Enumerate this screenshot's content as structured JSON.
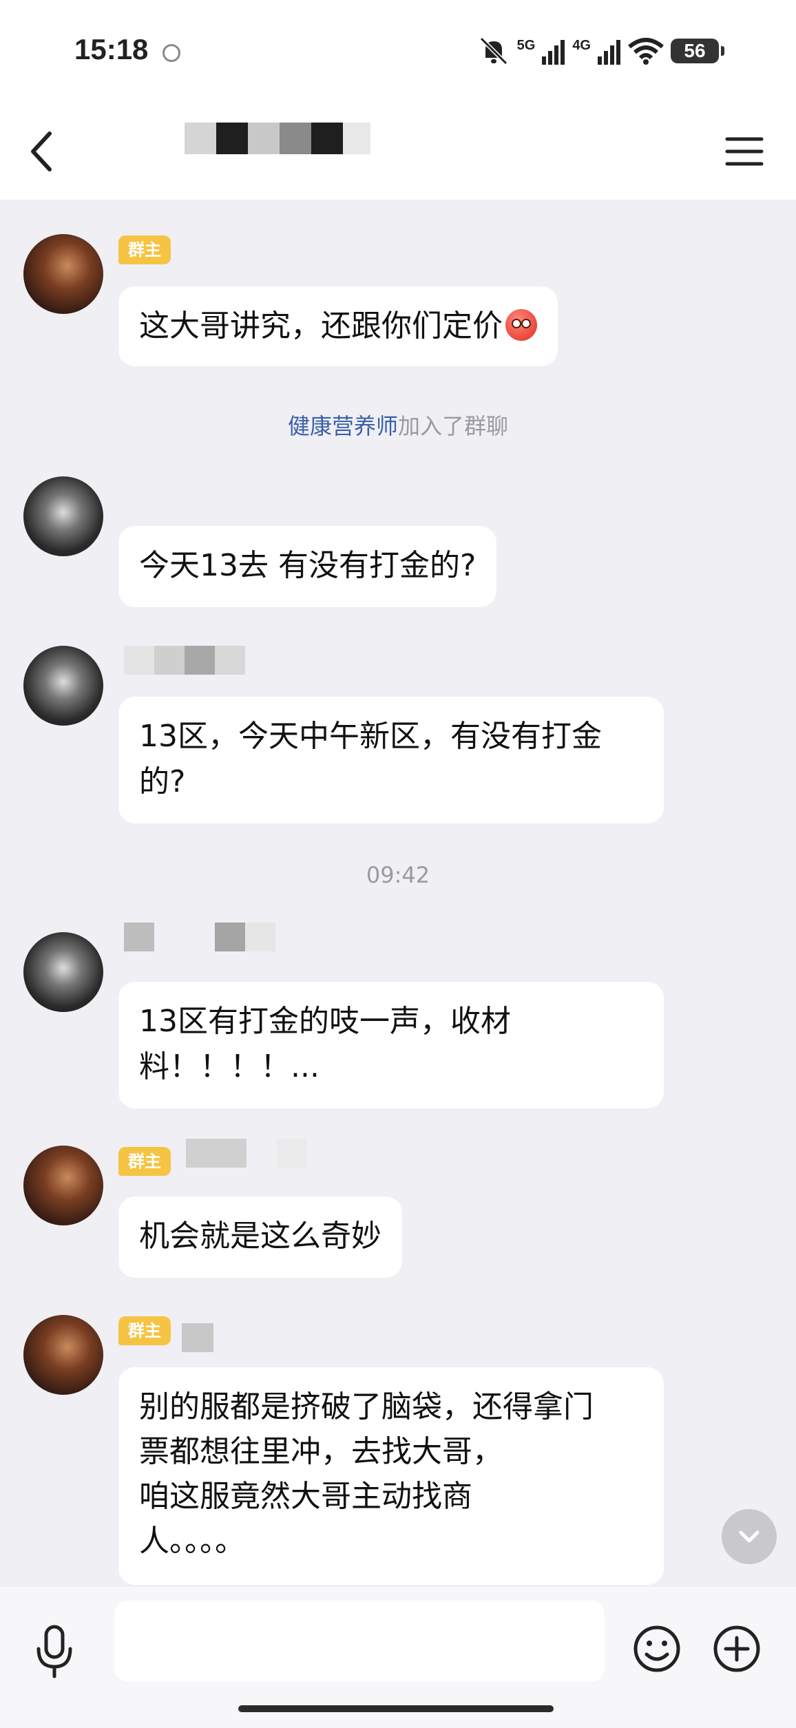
{
  "status_bar": {
    "time": "15:18",
    "network_5g": "5G",
    "network_4g": "4G",
    "battery": "56"
  },
  "nav": {
    "back_icon": "chevron-left-icon",
    "menu_icon": "hamburger-menu-icon"
  },
  "messages": [
    {
      "sender_role": "owner",
      "badge": "群主",
      "text": "这大哥讲究，还跟你们定价",
      "emoji": "flushed-face-emoji"
    },
    {
      "sender_role": "member",
      "text": "今天13去 有没有打金的?"
    },
    {
      "sender_role": "member",
      "line1": "13区，今天中午新区，有没有打金",
      "line2": "的?"
    },
    {
      "sender_role": "member",
      "line1": "13区有打金的吱一声，收材",
      "line2": "料！！！！..."
    },
    {
      "sender_role": "owner",
      "badge": "群主",
      "text": "机会就是这么奇妙"
    },
    {
      "sender_role": "owner",
      "badge": "群主",
      "line1": "别的服都是挤破了脑袋，还得拿门",
      "line2": "票都想往里冲，去找大哥，",
      "line3": "咱这服竟然大哥主动找商",
      "line4": "人。。。。"
    }
  ],
  "system_message": {
    "name": "健康营养师",
    "action": "加入了群聊"
  },
  "time_separator": "09:42",
  "input_bar": {
    "placeholder": "",
    "mic_icon": "microphone-icon",
    "emoji_icon": "smiley-face-icon",
    "plus_icon": "plus-circle-icon"
  },
  "colors": {
    "background": "#efeff4",
    "bubble": "#ffffff",
    "owner_badge": "#f6c443",
    "link": "#3a5fa8",
    "muted": "#9a9aa0"
  }
}
